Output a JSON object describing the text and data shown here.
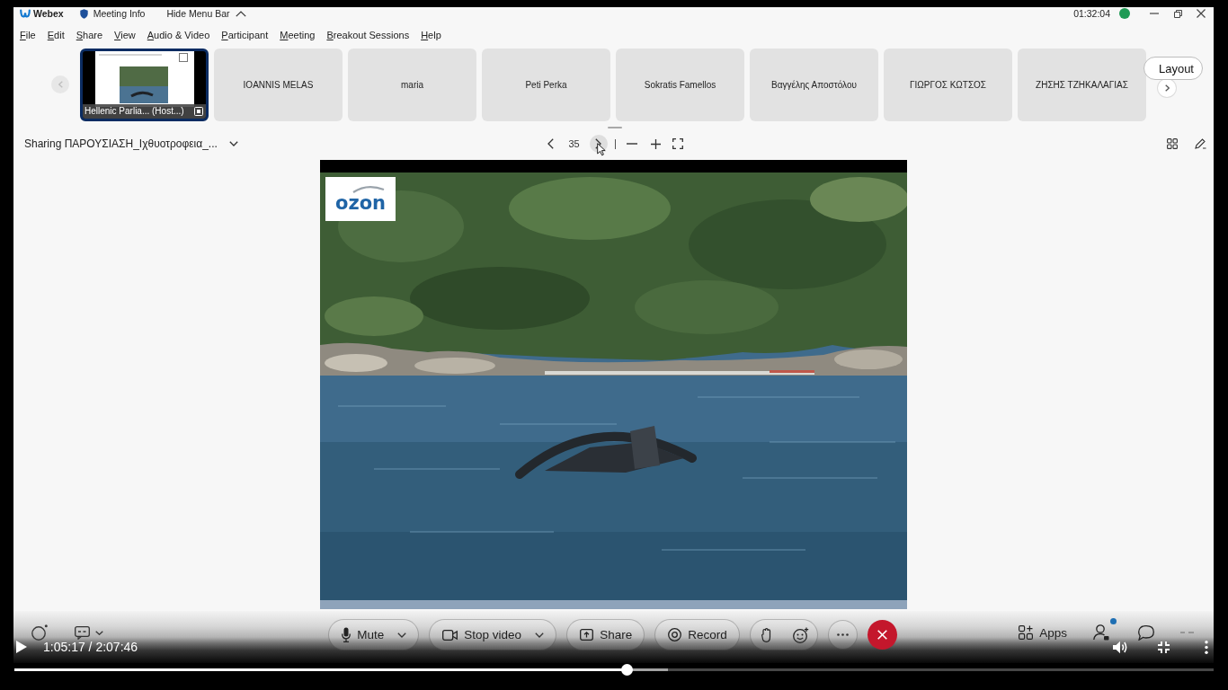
{
  "player": {
    "time": "1:05:17 / 2:07:46",
    "progress": {
      "level": 0.511
    },
    "buffer": {
      "level": 0.545
    }
  },
  "window": {
    "app_name": "Webex",
    "title_items": [
      {
        "kind": "info",
        "label": "Meeting Info"
      },
      {
        "kind": "toggle",
        "label": "Hide Menu Bar"
      }
    ],
    "clock": "01:32:04"
  },
  "menu": [
    "File",
    "Edit",
    "Share",
    "View",
    "Audio & Video",
    "Participant",
    "Meeting",
    "Breakout Sessions",
    "Help"
  ],
  "filmstrip": {
    "back": {
      "disabled": true
    },
    "forward": {
      "disabled": false
    },
    "tiles": [
      {
        "kind": "screen",
        "label": "Hellenic Parlia... (Host...)",
        "selected": true
      },
      {
        "kind": "name",
        "label": "IOANNIS MELAS",
        "selected": false
      },
      {
        "kind": "name",
        "label": "maria",
        "selected": false
      },
      {
        "kind": "name",
        "label": "Peti Perka",
        "selected": false
      },
      {
        "kind": "name",
        "label": "Sokratis Famellos",
        "selected": false
      },
      {
        "kind": "name",
        "label": "Βαγγέλης Αποστόλου",
        "selected": false
      },
      {
        "kind": "name",
        "label": "ΓΙΩΡΓΟΣ ΚΩΤΣΟΣ",
        "selected": false
      },
      {
        "kind": "name",
        "label": "ΖΗΣΗΣ ΤΖΗΚΑΛΑΓΙΑΣ",
        "selected": false
      }
    ],
    "layout_button": "Layout"
  },
  "sharing": {
    "title": "Sharing ΠΑΡΟΥΣΙΑΣΗ_Ιχθυοτροφεια_...",
    "page": "35",
    "next_page": {
      "hovered": true
    }
  },
  "slide": {
    "logo": "ozon"
  },
  "toolbar": {
    "buttons": [
      {
        "kind": "mic",
        "label": "Mute",
        "has_menu": true
      },
      {
        "kind": "camera",
        "label": "Stop video",
        "has_menu": true
      },
      {
        "kind": "share",
        "label": "Share",
        "has_menu": false
      },
      {
        "kind": "record",
        "label": "Record",
        "has_menu": false
      }
    ],
    "apps": "Apps",
    "participants": {
      "badge": true
    }
  }
}
